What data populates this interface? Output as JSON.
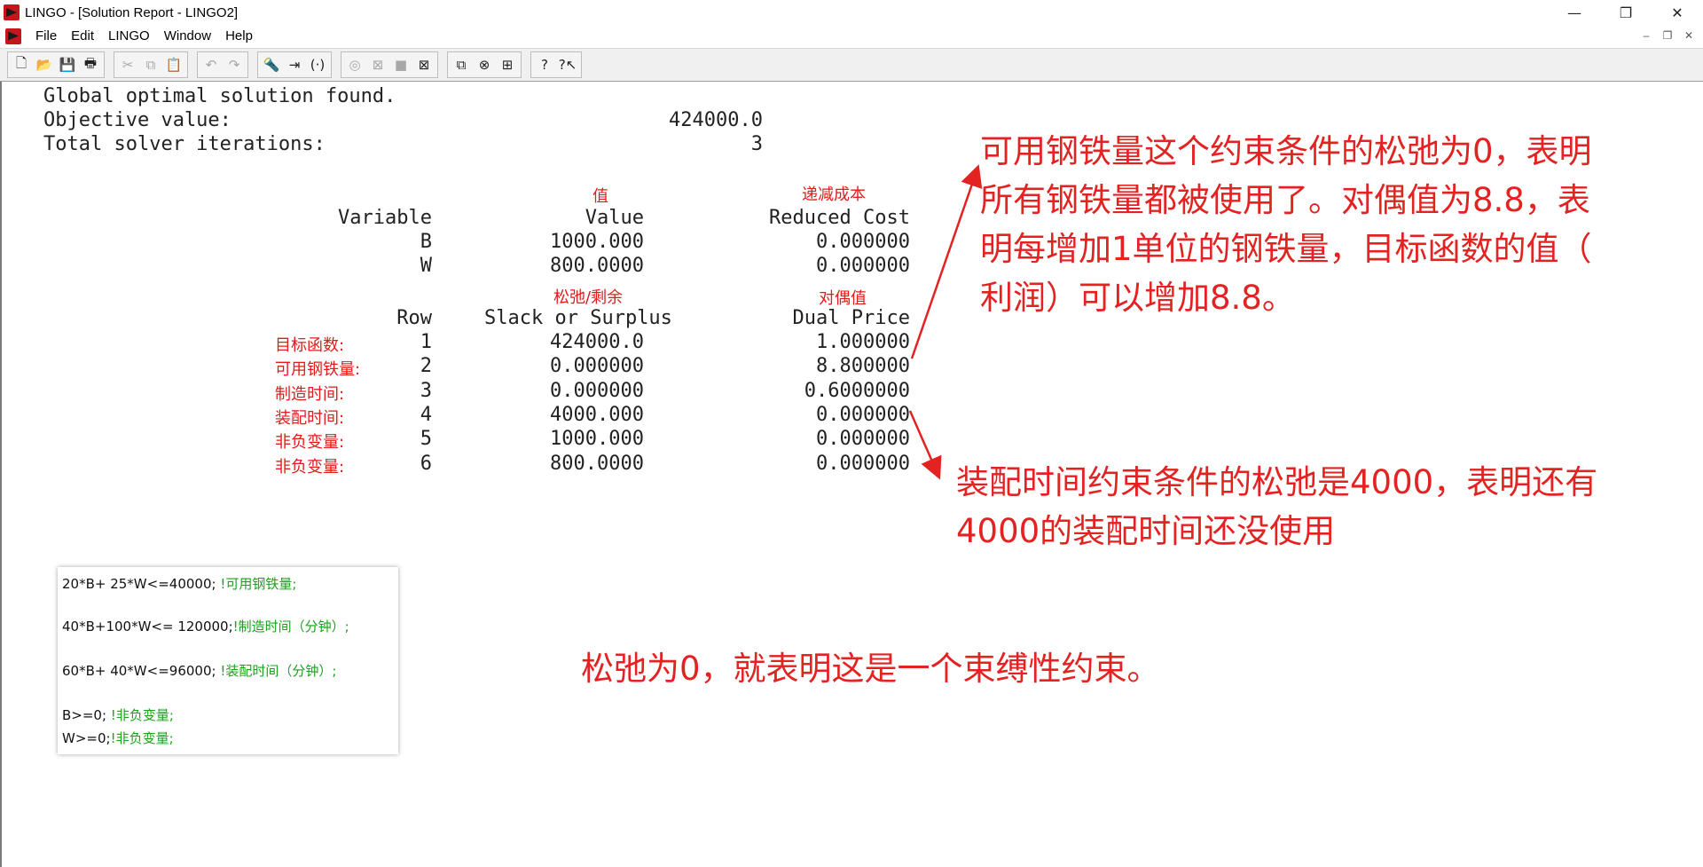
{
  "window": {
    "title": "LINGO - [Solution Report - LINGO2]",
    "controls": [
      "—",
      "❐",
      "✕"
    ],
    "mdi_controls": [
      "–",
      "❐",
      "✕"
    ]
  },
  "menu": [
    "File",
    "Edit",
    "LINGO",
    "Window",
    "Help"
  ],
  "toolbar": {
    "groups": [
      [
        {
          "icon": "new-file-icon",
          "glyph": "🗋",
          "enabled": true
        },
        {
          "icon": "open-folder-icon",
          "glyph": "📂",
          "enabled": true
        },
        {
          "icon": "save-icon",
          "glyph": "💾",
          "enabled": true
        },
        {
          "icon": "print-icon",
          "glyph": "🖶",
          "enabled": true
        }
      ],
      [
        {
          "icon": "cut-icon",
          "glyph": "✂",
          "enabled": false
        },
        {
          "icon": "copy-icon",
          "glyph": "⧉",
          "enabled": false
        },
        {
          "icon": "paste-icon",
          "glyph": "📋",
          "enabled": true
        }
      ],
      [
        {
          "icon": "undo-icon",
          "glyph": "↶",
          "enabled": false
        },
        {
          "icon": "redo-icon",
          "glyph": "↷",
          "enabled": false
        }
      ],
      [
        {
          "icon": "find-icon",
          "glyph": "🔦",
          "enabled": true
        },
        {
          "icon": "goto-line-icon",
          "glyph": "⇥",
          "enabled": true
        },
        {
          "icon": "match-paren-icon",
          "glyph": "(·)",
          "enabled": true
        }
      ],
      [
        {
          "icon": "solve-icon",
          "glyph": "◎",
          "enabled": false
        },
        {
          "icon": "compile-icon",
          "glyph": "⊠",
          "enabled": false
        },
        {
          "icon": "stop-icon",
          "glyph": "■",
          "enabled": false
        },
        {
          "icon": "close-all-icon",
          "glyph": "⊠",
          "enabled": true
        }
      ],
      [
        {
          "icon": "send-to-back-icon",
          "glyph": "⧉",
          "enabled": true
        },
        {
          "icon": "close-window-icon",
          "glyph": "⊗",
          "enabled": true
        },
        {
          "icon": "tile-icon",
          "glyph": "⊞",
          "enabled": true
        }
      ],
      [
        {
          "icon": "help-icon",
          "glyph": "?",
          "enabled": true
        },
        {
          "icon": "context-help-icon",
          "glyph": "?↖",
          "enabled": true
        }
      ]
    ]
  },
  "report": {
    "summary": [
      {
        "label": "Global optimal solution found.",
        "value": ""
      },
      {
        "label": "Objective value:",
        "value": "424000.0"
      },
      {
        "label": "Total solver iterations:",
        "value": "3"
      }
    ],
    "variables": {
      "header_cn_value": "值",
      "header_cn_reduced": "递减成本",
      "headers": [
        "Variable",
        "Value",
        "Reduced Cost"
      ],
      "rows": [
        {
          "name": "B",
          "value": "1000.000",
          "reduced": "0.000000"
        },
        {
          "name": "W",
          "value": "800.0000",
          "reduced": "0.000000"
        }
      ]
    },
    "rows": {
      "header_cn_slack": "松弛/剩余",
      "header_cn_dual": "对偶值",
      "headers": [
        "Row",
        "Slack or Surplus",
        "Dual Price"
      ],
      "items": [
        {
          "cn": "目标函数:",
          "row": "1",
          "slack": "424000.0",
          "dual": "1.000000"
        },
        {
          "cn": "可用钢铁量:",
          "row": "2",
          "slack": "0.000000",
          "dual": "8.800000"
        },
        {
          "cn": "制造时间:",
          "row": "3",
          "slack": "0.000000",
          "dual": "0.6000000"
        },
        {
          "cn": "装配时间:",
          "row": "4",
          "slack": "4000.000",
          "dual": "0.000000"
        },
        {
          "cn": "非负变量:",
          "row": "5",
          "slack": "1000.000",
          "dual": "0.000000"
        },
        {
          "cn": "非负变量:",
          "row": "6",
          "slack": "800.0000",
          "dual": "0.000000"
        }
      ]
    }
  },
  "annotations": {
    "steel": [
      "可用钢铁量这个约束条件的松弛为0，表明",
      "所有钢铁量都被使用了。对偶值为8.8，表",
      "明每增加1单位的钢铁量，目标函数的值（",
      "利润）可以增加8.8。"
    ],
    "assembly": [
      "装配时间约束条件的松弛是4000，表明还有",
      "4000的装配时间还没使用"
    ],
    "binding": "松弛为0，就表明这是一个束缚性约束。"
  },
  "code": [
    {
      "expr": "20*B+ 25*W<=40000;",
      "comment": " !可用钢铁量;"
    },
    {
      "expr": "40*B+100*W<= 120000;",
      "comment": "!制造时间（分钟）;"
    },
    {
      "expr": "60*B+ 40*W<=96000;",
      "comment": " !装配时间（分钟）;"
    },
    {
      "expr": "B>=0;",
      "comment": " !非负变量;"
    },
    {
      "expr": "W>=0;",
      "comment": "!非负变量;"
    }
  ],
  "colors": {
    "annotation": "#e32222",
    "comment": "#1aa31a",
    "label_red": "#e21b1b"
  }
}
